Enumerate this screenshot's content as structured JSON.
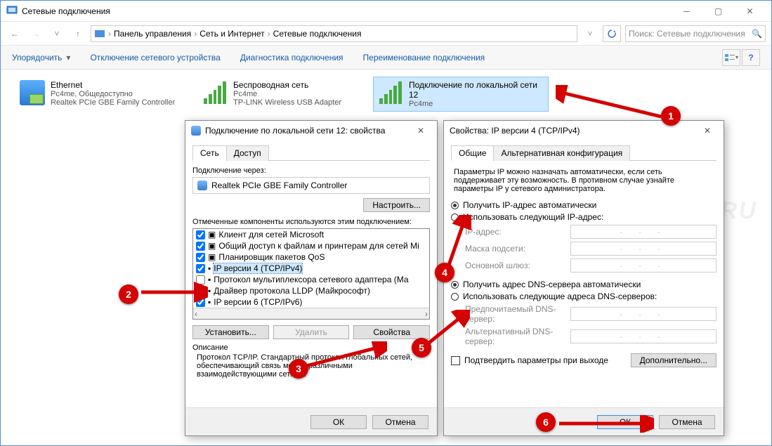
{
  "window": {
    "title": "Сетевые подключения",
    "breadcrumbs": [
      "Панель управления",
      "Сеть и Интернет",
      "Сетевые подключения"
    ],
    "search_placeholder": "Поиск: Сетевые подключения"
  },
  "toolbar": {
    "organize": "Упорядочить",
    "disable": "Отключение сетевого устройства",
    "diagnose": "Диагностика подключения",
    "rename": "Переименование подключения"
  },
  "connections": [
    {
      "name": "Ethernet",
      "status": "Pc4me, Общедоступно",
      "adapter": "Realtek PCIe GBE Family Controller",
      "icon": "wired"
    },
    {
      "name": "Беспроводная сеть",
      "status": "Pc4me",
      "adapter": "TP-LINK Wireless USB Adapter",
      "icon": "wifi"
    },
    {
      "name": "Подключение по локальной сети 12",
      "status": "Pc4me",
      "adapter": "",
      "icon": "wifi",
      "selected": true
    }
  ],
  "dlg_props": {
    "title": "Подключение по локальной сети 12: свойства",
    "tabs": [
      "Сеть",
      "Доступ"
    ],
    "connect_using_label": "Подключение через:",
    "adapter": "Realtek PCIe GBE Family Controller",
    "configure_btn": "Настроить...",
    "components_label": "Отмеченные компоненты используются этим подключением:",
    "components": [
      "Клиент для сетей Microsoft",
      "Общий доступ к файлам и принтерам для сетей Mi",
      "Планировщик пакетов QoS",
      "IP версии 4 (TCP/IPv4)",
      "Протокол мультиплексора сетевого адаптера (Ма",
      "Драйвер протокола LLDP (Майкрософт)",
      "IP версии 6 (TCP/IPv6)"
    ],
    "highlight_index": 3,
    "install_btn": "Установить...",
    "remove_btn": "Удалить",
    "properties_btn": "Свойства",
    "desc_label": "Описание",
    "desc_text": "Протокол TCP/IP. Стандартный протокол глобальных сетей, обеспечивающий связь между различными взаимодействующими сетями.",
    "ok": "ОК",
    "cancel": "Отмена"
  },
  "dlg_ipv4": {
    "title": "Свойства: IP версии 4 (TCP/IPv4)",
    "tabs": [
      "Общие",
      "Альтернативная конфигурация"
    ],
    "intro": "Параметры IP можно назначать автоматически, если сеть поддерживает эту возможность. В противном случае узнайте параметры IP у сетевого администратора.",
    "ip_auto": "Получить IP-адрес автоматически",
    "ip_manual": "Использовать следующий IP-адрес:",
    "ip_addr": "IP-адрес:",
    "mask": "Маска подсети:",
    "gateway": "Основной шлюз:",
    "dns_auto": "Получить адрес DNS-сервера автоматически",
    "dns_manual": "Использовать следующие адреса DNS-серверов:",
    "dns_pref": "Предпочитаемый DNS-сервер:",
    "dns_alt": "Альтернативный DNS-сервер:",
    "validate": "Подтвердить параметры при выходе",
    "advanced": "Дополнительно...",
    "ok": "ОК",
    "cancel": "Отмена"
  },
  "markers": {
    "m1": "1",
    "m2": "2",
    "m3": "3",
    "m4": "4",
    "m5": "5",
    "m6": "6"
  },
  "watermark": "PC4ME.RU"
}
